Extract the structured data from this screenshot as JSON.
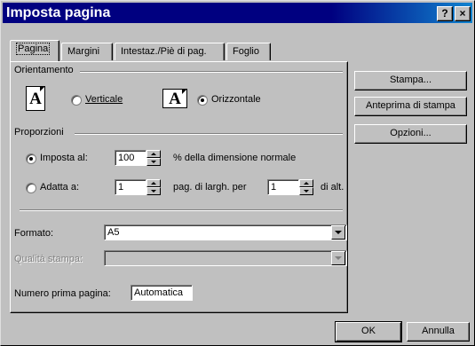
{
  "window": {
    "title": "Imposta pagina"
  },
  "titlebar_buttons": {
    "help": "?",
    "close": "×"
  },
  "tabs": [
    {
      "label": "Pagina"
    },
    {
      "label": "Margini"
    },
    {
      "label": "Intestaz./Piè di pag."
    },
    {
      "label": "Foglio"
    }
  ],
  "orientation": {
    "group_label": "Orientamento",
    "portrait_glyph": "A",
    "landscape_glyph": "A",
    "portrait_label": "Verticale",
    "landscape_label": "Orizzontale",
    "selected": "landscape"
  },
  "scaling": {
    "group_label": "Proporzioni",
    "adjust_label": "Imposta al:",
    "adjust_value": "100",
    "adjust_suffix": "% della dimensione normale",
    "fit_label": "Adatta a:",
    "fit_wide_value": "1",
    "fit_mid_label": "pag. di largh. per",
    "fit_tall_value": "1",
    "fit_suffix": "di alt.",
    "selected": "adjust"
  },
  "paper": {
    "label": "Formato:",
    "value": "A5"
  },
  "quality": {
    "label": "Qualità stampa:",
    "value": ""
  },
  "first_page": {
    "label": "Numero prima pagina:",
    "value": "Automatica"
  },
  "side_buttons": {
    "print": "Stampa...",
    "preview": "Anteprima di stampa",
    "options": "Opzioni..."
  },
  "footer_buttons": {
    "ok": "OK",
    "cancel": "Annulla"
  }
}
